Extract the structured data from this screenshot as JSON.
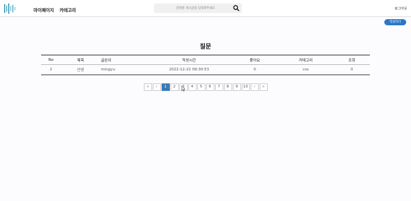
{
  "header": {
    "nav": [
      "마이페이지",
      "카테고리"
    ],
    "search_placeholder": "검색할 게시글을 입력해주세요",
    "login_label": "로그아웃"
  },
  "toolbar": {
    "write_label": "작성하기"
  },
  "main": {
    "title": "질문",
    "columns": [
      "No",
      "제목",
      "글쓴이",
      "작성시간",
      "좋아요",
      "카테고리",
      "조회"
    ],
    "rows": [
      [
        "2",
        "안녕",
        "mingyu",
        "2022-12-22 09:30:53",
        "0",
        "css",
        "0"
      ]
    ]
  },
  "pagination": {
    "first": "«",
    "prev": "‹",
    "pages": [
      "1",
      "2",
      "3",
      "4",
      "5",
      "6",
      "7",
      "8",
      "9",
      "10"
    ],
    "next": "›",
    "last": "»",
    "current": "1"
  },
  "colors": {
    "accent": "#2a77c9",
    "active_page": "#3c79b4"
  }
}
